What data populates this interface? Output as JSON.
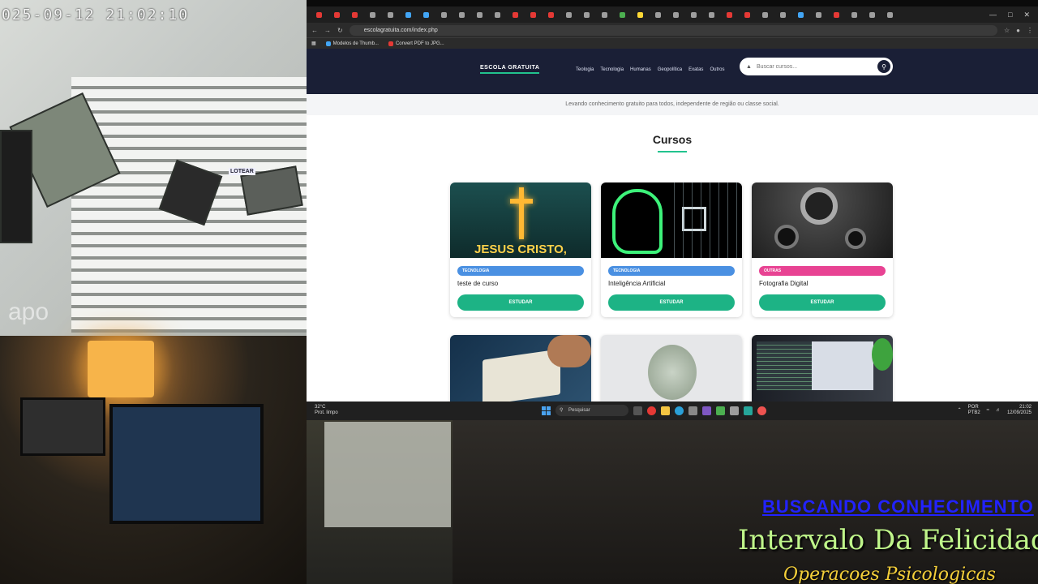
{
  "camera": {
    "timestamp": "025-09-12  21:02:10",
    "watermark": "apo",
    "shop_sign": "LOTEAR"
  },
  "overlays": {
    "blue_text": "BUSCANDO CONHECIMENTO",
    "green_text": "Intervalo Da Felicidade",
    "yellow_text": "Operacoes Psicologicas"
  },
  "browser": {
    "url": "escolagratuita.com/index.php",
    "bookmarks": [
      "Modelos de Thumb...",
      "Convert PDF to JPG..."
    ],
    "tab_colors": [
      "#e53935",
      "#e53935",
      "#e53935",
      "#9e9e9e",
      "#9e9e9e",
      "#42a5f5",
      "#42a5f5",
      "#9e9e9e",
      "#9e9e9e",
      "#9e9e9e",
      "#9e9e9e",
      "#e53935",
      "#e53935",
      "#e53935",
      "#9e9e9e",
      "#9e9e9e",
      "#9e9e9e",
      "#4caf50",
      "#fdd835",
      "#9e9e9e",
      "#9e9e9e",
      "#9e9e9e",
      "#9e9e9e",
      "#e53935",
      "#e53935",
      "#9e9e9e",
      "#9e9e9e",
      "#42a5f5",
      "#9e9e9e",
      "#e53935",
      "#9e9e9e",
      "#9e9e9e",
      "#9e9e9e"
    ]
  },
  "site": {
    "logo": "ESCOLA GRATUITA",
    "nav": [
      "Teologia",
      "Tecnologia",
      "Humanas",
      "Geopolítica",
      "Exatas",
      "Outros"
    ],
    "search_placeholder": "Buscar cursos...",
    "tagline": "Levando conhecimento gratuito para todos, independente de região ou classe social.",
    "section_title": "Cursos",
    "courses": [
      {
        "category": "TECNOLOGIA",
        "category_color": "#4a90e2",
        "name": "teste de curso",
        "button": "ESTUDAR",
        "image_text": "JESUS CRISTO,"
      },
      {
        "category": "TECNOLOGIA",
        "category_color": "#4a90e2",
        "name": "Inteligência Artificial",
        "button": "ESTUDAR"
      },
      {
        "category": "OUTRAS",
        "category_color": "#e84393",
        "name": "Fotografia Digital",
        "button": "ESTUDAR"
      }
    ]
  },
  "taskbar": {
    "weather_temp": "32°C",
    "weather_desc": "Prot. limpo",
    "search_label": "Pesquisar",
    "lang": "POR",
    "lang2": "PTB2",
    "time": "21:02",
    "date": "12/09/2025"
  }
}
